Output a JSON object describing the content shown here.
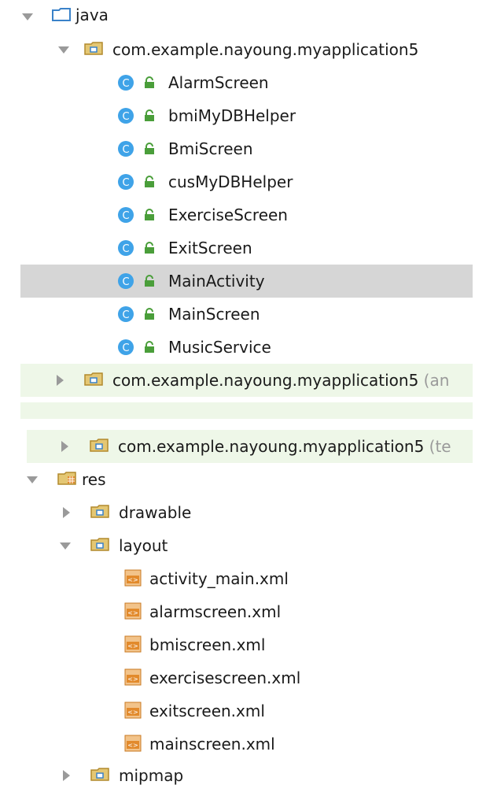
{
  "tree": {
    "java_label": "java",
    "package_main": "com.example.nayoung.myapplication5",
    "classes": [
      "AlarmScreen",
      "bmiMyDBHelper",
      "BmiScreen",
      "cusMyDBHelper",
      "ExerciseScreen",
      "ExitScreen",
      "MainActivity",
      "MainScreen",
      "MusicService"
    ],
    "package_android": "com.example.nayoung.myapplication5",
    "package_android_suffix": "(an",
    "package_test": "com.example.nayoung.myapplication5",
    "package_test_suffix": "(te",
    "res_label": "res",
    "drawable_label": "drawable",
    "layout_label": "layout",
    "layout_files": [
      "activity_main.xml",
      "alarmscreen.xml",
      "bmiscreen.xml",
      "exercisescreen.xml",
      "exitscreen.xml",
      "mainscreen.xml"
    ],
    "mipmap_label": "mipmap"
  },
  "colors": {
    "selected_bg": "#d6d6d6",
    "test_bg": "#eef7e8",
    "class_icon": "#3fa3e8",
    "lock_icon": "#4a9e3a",
    "xml_icon": "#e28a2c"
  }
}
